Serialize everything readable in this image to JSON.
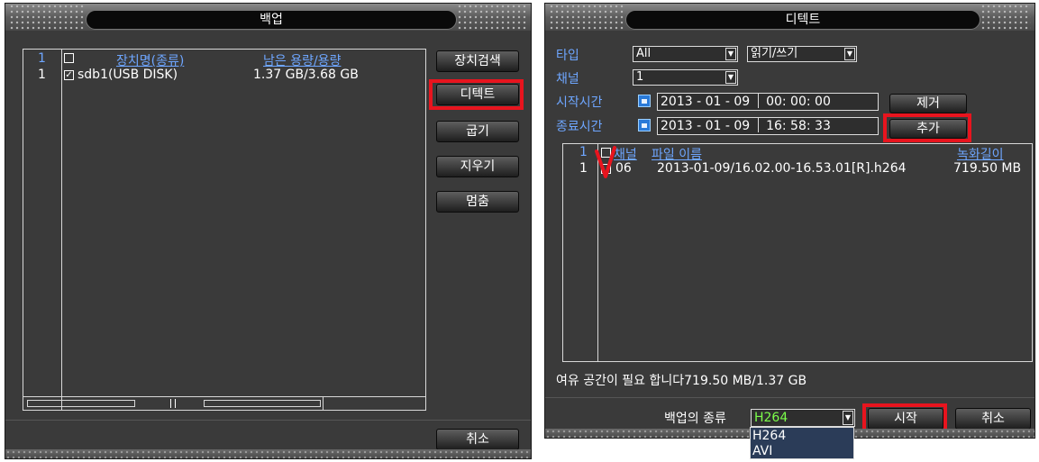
{
  "left": {
    "title": "백업",
    "table": {
      "headers": {
        "index": "1",
        "name": "장치명(종류)",
        "capacity": "남은 용량/용량"
      },
      "rows": [
        {
          "index": "1",
          "name": "sdb1(USB DISK)",
          "capacity": "1.37 GB/3.68 GB"
        }
      ]
    },
    "buttons": {
      "search": "장치검색",
      "detect": "디텍트",
      "burn": "굽기",
      "erase": "지우기",
      "stop": "멈춤",
      "cancel": "취소"
    }
  },
  "right": {
    "title": "디텍트",
    "type_label": "타입",
    "type_value": "All",
    "rw_value": "읽기/쓰기",
    "channel_label": "채널",
    "channel_value": "1",
    "start_label": "시작시간",
    "start_date": "2013 - 01 - 09",
    "start_time": "00: 00: 00",
    "end_label": "종료시간",
    "end_date": "2013 - 01 - 09",
    "end_time": "16: 58: 33",
    "remove_button": "제거",
    "add_button": "추가",
    "table": {
      "headers": {
        "index": "1",
        "channel": "채널",
        "filename": "파일 이름",
        "length": "녹화길이"
      },
      "rows": [
        {
          "index": "1",
          "channel": "06",
          "filename": "2013-01-09/16.02.00-16.53.01[R].h264",
          "length": "719.50 MB"
        }
      ]
    },
    "status_text": "여유 공간이 필요 합니다719.50 MB/1.37 GB",
    "backup_type_label": "백업의 종류",
    "backup_type_value": "H264",
    "backup_type_options": [
      "H264",
      "AVI"
    ],
    "start_button": "시작",
    "cancel_button": "취소"
  },
  "colors": {
    "panel_bg": "#3a3a3a",
    "header_text": "#6ea6ff",
    "highlight": "#e8141e",
    "codec_text": "#7cff4a"
  }
}
